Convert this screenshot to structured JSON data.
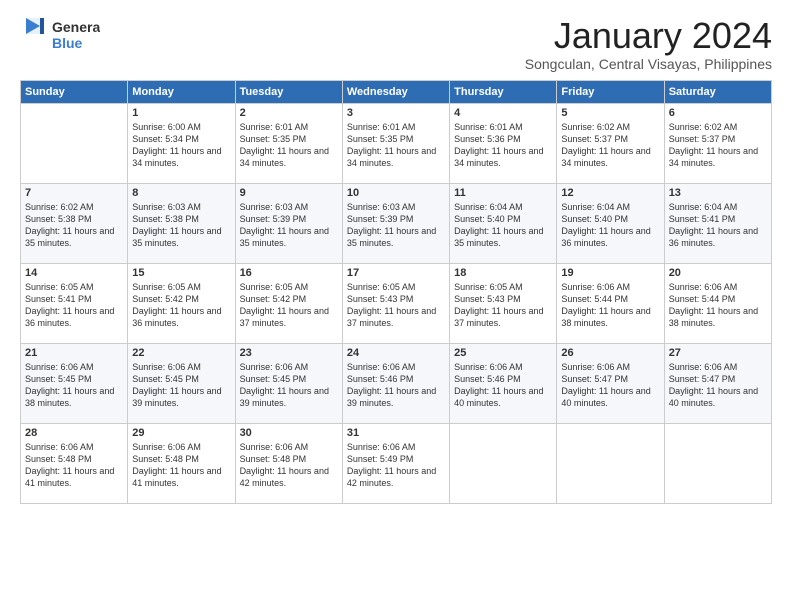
{
  "header": {
    "logo_general": "General",
    "logo_blue": "Blue",
    "month_title": "January 2024",
    "subtitle": "Songculan, Central Visayas, Philippines"
  },
  "days_of_week": [
    "Sunday",
    "Monday",
    "Tuesday",
    "Wednesday",
    "Thursday",
    "Friday",
    "Saturday"
  ],
  "weeks": [
    [
      {
        "day": "",
        "sunrise": "",
        "sunset": "",
        "daylight": ""
      },
      {
        "day": "1",
        "sunrise": "Sunrise: 6:00 AM",
        "sunset": "Sunset: 5:34 PM",
        "daylight": "Daylight: 11 hours and 34 minutes."
      },
      {
        "day": "2",
        "sunrise": "Sunrise: 6:01 AM",
        "sunset": "Sunset: 5:35 PM",
        "daylight": "Daylight: 11 hours and 34 minutes."
      },
      {
        "day": "3",
        "sunrise": "Sunrise: 6:01 AM",
        "sunset": "Sunset: 5:35 PM",
        "daylight": "Daylight: 11 hours and 34 minutes."
      },
      {
        "day": "4",
        "sunrise": "Sunrise: 6:01 AM",
        "sunset": "Sunset: 5:36 PM",
        "daylight": "Daylight: 11 hours and 34 minutes."
      },
      {
        "day": "5",
        "sunrise": "Sunrise: 6:02 AM",
        "sunset": "Sunset: 5:37 PM",
        "daylight": "Daylight: 11 hours and 34 minutes."
      },
      {
        "day": "6",
        "sunrise": "Sunrise: 6:02 AM",
        "sunset": "Sunset: 5:37 PM",
        "daylight": "Daylight: 11 hours and 34 minutes."
      }
    ],
    [
      {
        "day": "7",
        "sunrise": "Sunrise: 6:02 AM",
        "sunset": "Sunset: 5:38 PM",
        "daylight": "Daylight: 11 hours and 35 minutes."
      },
      {
        "day": "8",
        "sunrise": "Sunrise: 6:03 AM",
        "sunset": "Sunset: 5:38 PM",
        "daylight": "Daylight: 11 hours and 35 minutes."
      },
      {
        "day": "9",
        "sunrise": "Sunrise: 6:03 AM",
        "sunset": "Sunset: 5:39 PM",
        "daylight": "Daylight: 11 hours and 35 minutes."
      },
      {
        "day": "10",
        "sunrise": "Sunrise: 6:03 AM",
        "sunset": "Sunset: 5:39 PM",
        "daylight": "Daylight: 11 hours and 35 minutes."
      },
      {
        "day": "11",
        "sunrise": "Sunrise: 6:04 AM",
        "sunset": "Sunset: 5:40 PM",
        "daylight": "Daylight: 11 hours and 35 minutes."
      },
      {
        "day": "12",
        "sunrise": "Sunrise: 6:04 AM",
        "sunset": "Sunset: 5:40 PM",
        "daylight": "Daylight: 11 hours and 36 minutes."
      },
      {
        "day": "13",
        "sunrise": "Sunrise: 6:04 AM",
        "sunset": "Sunset: 5:41 PM",
        "daylight": "Daylight: 11 hours and 36 minutes."
      }
    ],
    [
      {
        "day": "14",
        "sunrise": "Sunrise: 6:05 AM",
        "sunset": "Sunset: 5:41 PM",
        "daylight": "Daylight: 11 hours and 36 minutes."
      },
      {
        "day": "15",
        "sunrise": "Sunrise: 6:05 AM",
        "sunset": "Sunset: 5:42 PM",
        "daylight": "Daylight: 11 hours and 36 minutes."
      },
      {
        "day": "16",
        "sunrise": "Sunrise: 6:05 AM",
        "sunset": "Sunset: 5:42 PM",
        "daylight": "Daylight: 11 hours and 37 minutes."
      },
      {
        "day": "17",
        "sunrise": "Sunrise: 6:05 AM",
        "sunset": "Sunset: 5:43 PM",
        "daylight": "Daylight: 11 hours and 37 minutes."
      },
      {
        "day": "18",
        "sunrise": "Sunrise: 6:05 AM",
        "sunset": "Sunset: 5:43 PM",
        "daylight": "Daylight: 11 hours and 37 minutes."
      },
      {
        "day": "19",
        "sunrise": "Sunrise: 6:06 AM",
        "sunset": "Sunset: 5:44 PM",
        "daylight": "Daylight: 11 hours and 38 minutes."
      },
      {
        "day": "20",
        "sunrise": "Sunrise: 6:06 AM",
        "sunset": "Sunset: 5:44 PM",
        "daylight": "Daylight: 11 hours and 38 minutes."
      }
    ],
    [
      {
        "day": "21",
        "sunrise": "Sunrise: 6:06 AM",
        "sunset": "Sunset: 5:45 PM",
        "daylight": "Daylight: 11 hours and 38 minutes."
      },
      {
        "day": "22",
        "sunrise": "Sunrise: 6:06 AM",
        "sunset": "Sunset: 5:45 PM",
        "daylight": "Daylight: 11 hours and 39 minutes."
      },
      {
        "day": "23",
        "sunrise": "Sunrise: 6:06 AM",
        "sunset": "Sunset: 5:45 PM",
        "daylight": "Daylight: 11 hours and 39 minutes."
      },
      {
        "day": "24",
        "sunrise": "Sunrise: 6:06 AM",
        "sunset": "Sunset: 5:46 PM",
        "daylight": "Daylight: 11 hours and 39 minutes."
      },
      {
        "day": "25",
        "sunrise": "Sunrise: 6:06 AM",
        "sunset": "Sunset: 5:46 PM",
        "daylight": "Daylight: 11 hours and 40 minutes."
      },
      {
        "day": "26",
        "sunrise": "Sunrise: 6:06 AM",
        "sunset": "Sunset: 5:47 PM",
        "daylight": "Daylight: 11 hours and 40 minutes."
      },
      {
        "day": "27",
        "sunrise": "Sunrise: 6:06 AM",
        "sunset": "Sunset: 5:47 PM",
        "daylight": "Daylight: 11 hours and 40 minutes."
      }
    ],
    [
      {
        "day": "28",
        "sunrise": "Sunrise: 6:06 AM",
        "sunset": "Sunset: 5:48 PM",
        "daylight": "Daylight: 11 hours and 41 minutes."
      },
      {
        "day": "29",
        "sunrise": "Sunrise: 6:06 AM",
        "sunset": "Sunset: 5:48 PM",
        "daylight": "Daylight: 11 hours and 41 minutes."
      },
      {
        "day": "30",
        "sunrise": "Sunrise: 6:06 AM",
        "sunset": "Sunset: 5:48 PM",
        "daylight": "Daylight: 11 hours and 42 minutes."
      },
      {
        "day": "31",
        "sunrise": "Sunrise: 6:06 AM",
        "sunset": "Sunset: 5:49 PM",
        "daylight": "Daylight: 11 hours and 42 minutes."
      },
      {
        "day": "",
        "sunrise": "",
        "sunset": "",
        "daylight": ""
      },
      {
        "day": "",
        "sunrise": "",
        "sunset": "",
        "daylight": ""
      },
      {
        "day": "",
        "sunrise": "",
        "sunset": "",
        "daylight": ""
      }
    ]
  ]
}
